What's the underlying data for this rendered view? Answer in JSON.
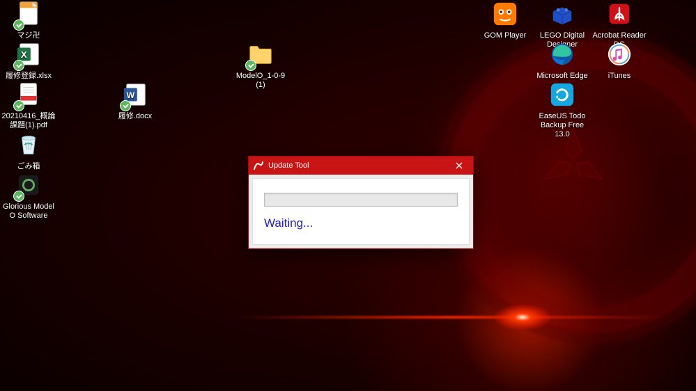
{
  "window": {
    "title": "Update Tool",
    "status": "Waiting..."
  },
  "icons": {
    "left": [
      {
        "name": "maji",
        "label": "マジ卍",
        "type": "file-orange"
      },
      {
        "name": "rishu-xlsx",
        "label": "履修登録.xlsx",
        "type": "xlsx"
      },
      {
        "name": "pdf-20210416",
        "label": "20210416_概論課題(1).pdf",
        "type": "pdf"
      },
      {
        "name": "gomibako",
        "label": "ごみ箱",
        "type": "recycle"
      },
      {
        "name": "glorious",
        "label": "Glorious Model O Software",
        "type": "exe-green"
      }
    ],
    "col2": [
      {
        "name": "rishu-docx",
        "label": "履修.docx",
        "type": "docx"
      }
    ],
    "col3": [
      {
        "name": "modelo",
        "label": "ModelO_1-0-9 (1)",
        "type": "folder"
      }
    ],
    "rightRow1": [
      {
        "name": "gom",
        "label": "GOM Player",
        "type": "gom"
      },
      {
        "name": "lego",
        "label": "LEGO Digital Designer",
        "type": "lego"
      },
      {
        "name": "acrobat",
        "label": "Acrobat Reader DC",
        "type": "acrobat"
      }
    ],
    "rightRow2": [
      {
        "name": "edge",
        "label": "Microsoft Edge",
        "type": "edge"
      },
      {
        "name": "itunes",
        "label": "iTunes",
        "type": "itunes"
      }
    ],
    "rightRow3": [
      {
        "name": "easeus",
        "label": "EaseUS Todo Backup Free 13.0",
        "type": "easeus"
      }
    ]
  }
}
